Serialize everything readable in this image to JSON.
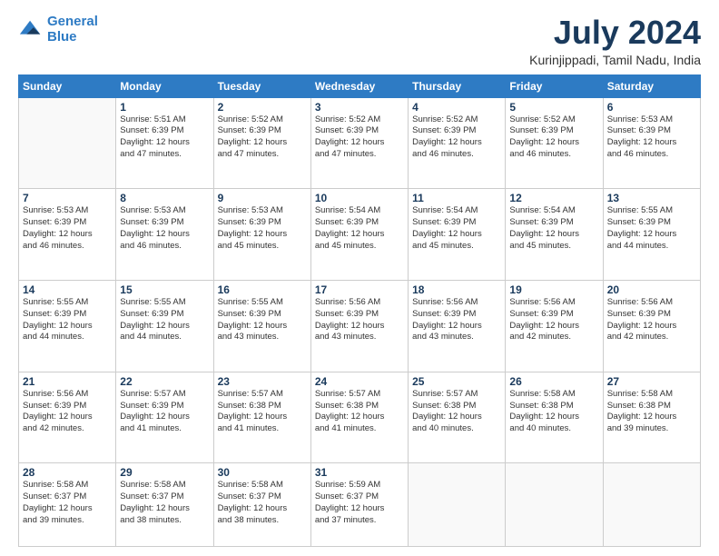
{
  "logo": {
    "line1": "General",
    "line2": "Blue"
  },
  "header": {
    "title": "July 2024",
    "subtitle": "Kurinjippadi, Tamil Nadu, India"
  },
  "days_of_week": [
    "Sunday",
    "Monday",
    "Tuesday",
    "Wednesday",
    "Thursday",
    "Friday",
    "Saturday"
  ],
  "weeks": [
    [
      {
        "day": "",
        "info": ""
      },
      {
        "day": "1",
        "info": "Sunrise: 5:51 AM\nSunset: 6:39 PM\nDaylight: 12 hours\nand 47 minutes."
      },
      {
        "day": "2",
        "info": "Sunrise: 5:52 AM\nSunset: 6:39 PM\nDaylight: 12 hours\nand 47 minutes."
      },
      {
        "day": "3",
        "info": "Sunrise: 5:52 AM\nSunset: 6:39 PM\nDaylight: 12 hours\nand 47 minutes."
      },
      {
        "day": "4",
        "info": "Sunrise: 5:52 AM\nSunset: 6:39 PM\nDaylight: 12 hours\nand 46 minutes."
      },
      {
        "day": "5",
        "info": "Sunrise: 5:52 AM\nSunset: 6:39 PM\nDaylight: 12 hours\nand 46 minutes."
      },
      {
        "day": "6",
        "info": "Sunrise: 5:53 AM\nSunset: 6:39 PM\nDaylight: 12 hours\nand 46 minutes."
      }
    ],
    [
      {
        "day": "7",
        "info": "Sunrise: 5:53 AM\nSunset: 6:39 PM\nDaylight: 12 hours\nand 46 minutes."
      },
      {
        "day": "8",
        "info": "Sunrise: 5:53 AM\nSunset: 6:39 PM\nDaylight: 12 hours\nand 46 minutes."
      },
      {
        "day": "9",
        "info": "Sunrise: 5:53 AM\nSunset: 6:39 PM\nDaylight: 12 hours\nand 45 minutes."
      },
      {
        "day": "10",
        "info": "Sunrise: 5:54 AM\nSunset: 6:39 PM\nDaylight: 12 hours\nand 45 minutes."
      },
      {
        "day": "11",
        "info": "Sunrise: 5:54 AM\nSunset: 6:39 PM\nDaylight: 12 hours\nand 45 minutes."
      },
      {
        "day": "12",
        "info": "Sunrise: 5:54 AM\nSunset: 6:39 PM\nDaylight: 12 hours\nand 45 minutes."
      },
      {
        "day": "13",
        "info": "Sunrise: 5:55 AM\nSunset: 6:39 PM\nDaylight: 12 hours\nand 44 minutes."
      }
    ],
    [
      {
        "day": "14",
        "info": "Sunrise: 5:55 AM\nSunset: 6:39 PM\nDaylight: 12 hours\nand 44 minutes."
      },
      {
        "day": "15",
        "info": "Sunrise: 5:55 AM\nSunset: 6:39 PM\nDaylight: 12 hours\nand 44 minutes."
      },
      {
        "day": "16",
        "info": "Sunrise: 5:55 AM\nSunset: 6:39 PM\nDaylight: 12 hours\nand 43 minutes."
      },
      {
        "day": "17",
        "info": "Sunrise: 5:56 AM\nSunset: 6:39 PM\nDaylight: 12 hours\nand 43 minutes."
      },
      {
        "day": "18",
        "info": "Sunrise: 5:56 AM\nSunset: 6:39 PM\nDaylight: 12 hours\nand 43 minutes."
      },
      {
        "day": "19",
        "info": "Sunrise: 5:56 AM\nSunset: 6:39 PM\nDaylight: 12 hours\nand 42 minutes."
      },
      {
        "day": "20",
        "info": "Sunrise: 5:56 AM\nSunset: 6:39 PM\nDaylight: 12 hours\nand 42 minutes."
      }
    ],
    [
      {
        "day": "21",
        "info": "Sunrise: 5:56 AM\nSunset: 6:39 PM\nDaylight: 12 hours\nand 42 minutes."
      },
      {
        "day": "22",
        "info": "Sunrise: 5:57 AM\nSunset: 6:39 PM\nDaylight: 12 hours\nand 41 minutes."
      },
      {
        "day": "23",
        "info": "Sunrise: 5:57 AM\nSunset: 6:38 PM\nDaylight: 12 hours\nand 41 minutes."
      },
      {
        "day": "24",
        "info": "Sunrise: 5:57 AM\nSunset: 6:38 PM\nDaylight: 12 hours\nand 41 minutes."
      },
      {
        "day": "25",
        "info": "Sunrise: 5:57 AM\nSunset: 6:38 PM\nDaylight: 12 hours\nand 40 minutes."
      },
      {
        "day": "26",
        "info": "Sunrise: 5:58 AM\nSunset: 6:38 PM\nDaylight: 12 hours\nand 40 minutes."
      },
      {
        "day": "27",
        "info": "Sunrise: 5:58 AM\nSunset: 6:38 PM\nDaylight: 12 hours\nand 39 minutes."
      }
    ],
    [
      {
        "day": "28",
        "info": "Sunrise: 5:58 AM\nSunset: 6:37 PM\nDaylight: 12 hours\nand 39 minutes."
      },
      {
        "day": "29",
        "info": "Sunrise: 5:58 AM\nSunset: 6:37 PM\nDaylight: 12 hours\nand 38 minutes."
      },
      {
        "day": "30",
        "info": "Sunrise: 5:58 AM\nSunset: 6:37 PM\nDaylight: 12 hours\nand 38 minutes."
      },
      {
        "day": "31",
        "info": "Sunrise: 5:59 AM\nSunset: 6:37 PM\nDaylight: 12 hours\nand 37 minutes."
      },
      {
        "day": "",
        "info": ""
      },
      {
        "day": "",
        "info": ""
      },
      {
        "day": "",
        "info": ""
      }
    ]
  ]
}
